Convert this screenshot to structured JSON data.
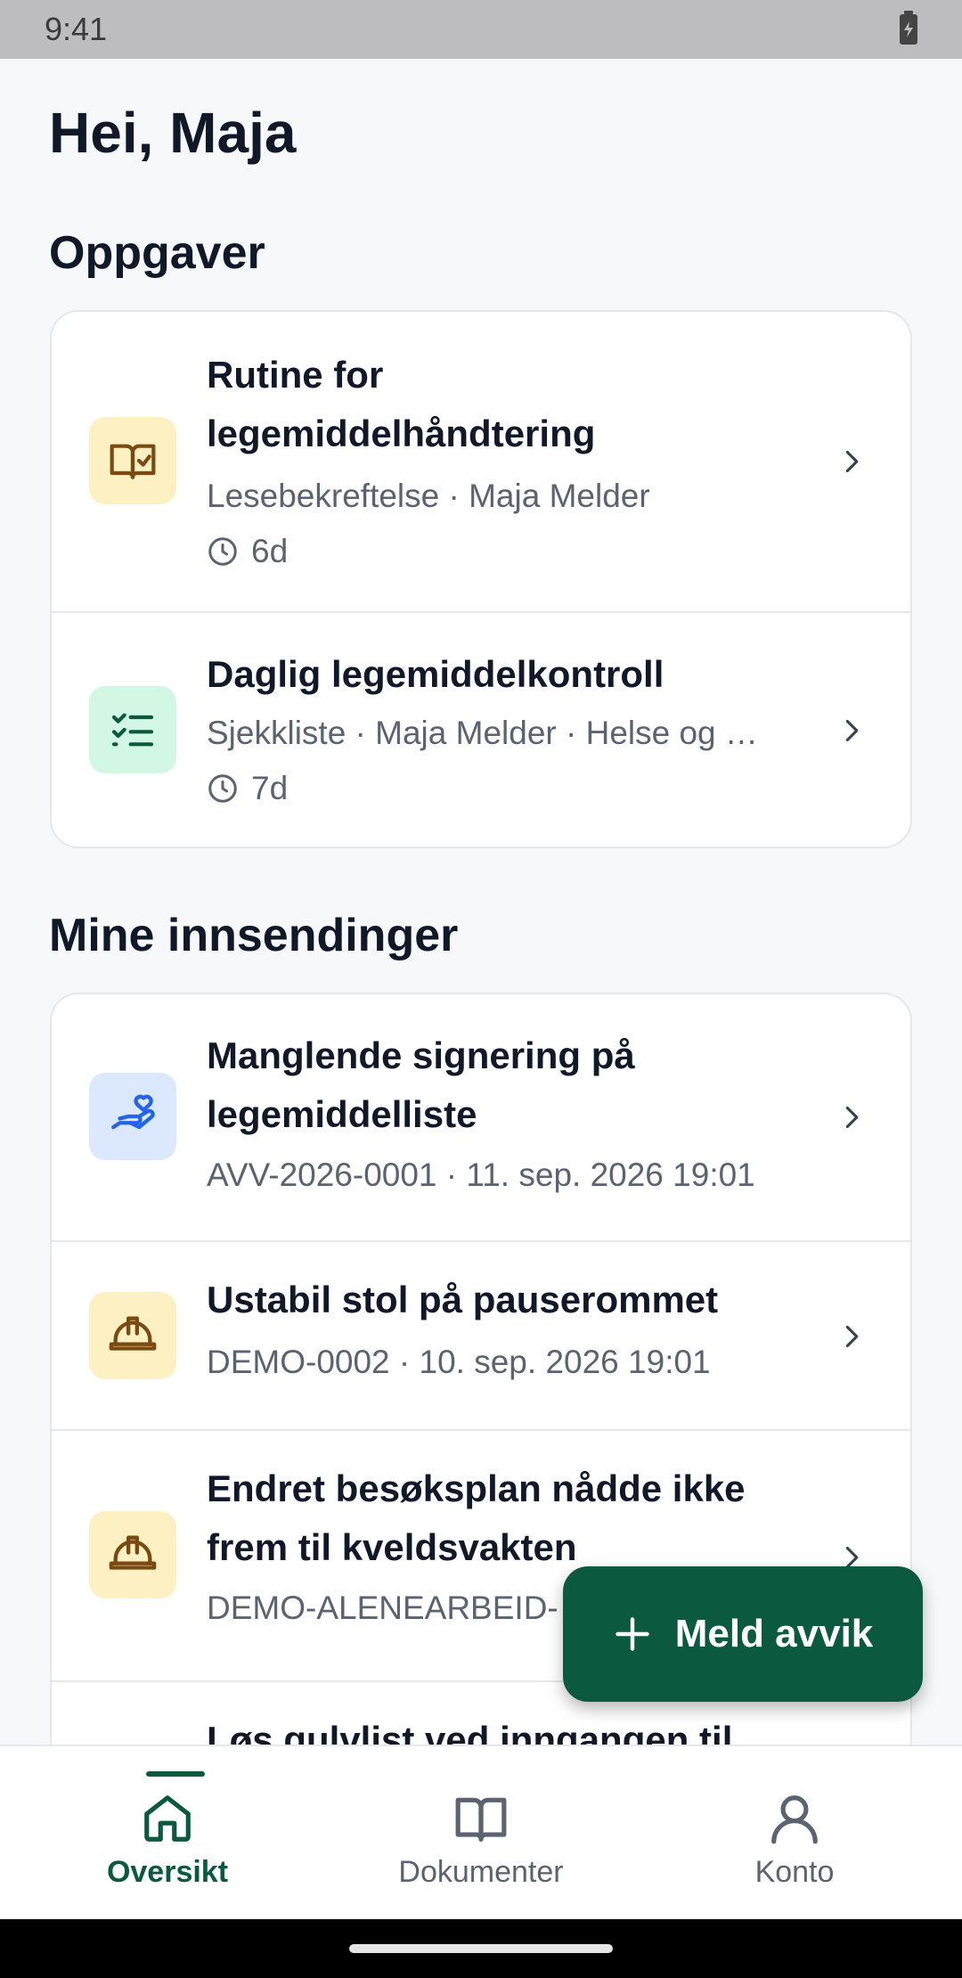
{
  "status_bar": {
    "time": "9:41"
  },
  "greeting": "Hei, Maja",
  "tasks": {
    "title": "Oppgaver",
    "items": [
      {
        "title_line1": "Rutine for",
        "title_line2": "legemiddelhåndtering",
        "subtitle": "Lesebekreftelse · Maja Melder",
        "due": "6d",
        "icon": "book-check-icon"
      },
      {
        "title": "Daglig legemiddelkontroll",
        "subtitle": "Sjekkliste · Maja Melder · Helse og …",
        "due": "7d",
        "icon": "checklist-icon"
      }
    ]
  },
  "submissions": {
    "title": "Mine innsendinger",
    "items": [
      {
        "title_line1": "Manglende signering på",
        "title_line2": "legemiddelliste",
        "subtitle": "AVV-2026-0001 · 11. sep. 2026 19:01",
        "icon": "hand-heart-icon"
      },
      {
        "title": "Ustabil stol på pauserommet",
        "subtitle": "DEMO-0002 · 10. sep. 2026 19:01",
        "icon": "hard-hat-icon"
      },
      {
        "title_line1": "Endret besøksplan nådde ikke",
        "title_line2": "frem til kveldsvakten",
        "subtitle": "DEMO-ALENEARBEID-",
        "icon": "hard-hat-icon"
      },
      {
        "title_line1": "Løs gulvlist ved inngangen til"
      }
    ]
  },
  "fab": {
    "label": "Meld avvik"
  },
  "nav": {
    "items": [
      {
        "label": "Oversikt",
        "icon": "home-icon"
      },
      {
        "label": "Dokumenter",
        "icon": "book-icon"
      },
      {
        "label": "Konto",
        "icon": "user-icon"
      }
    ]
  },
  "colors": {
    "brand": "#0b5a3f",
    "yellow": "#fdf1c4",
    "green": "#d2f7e4",
    "blue": "#dbe8fd"
  }
}
